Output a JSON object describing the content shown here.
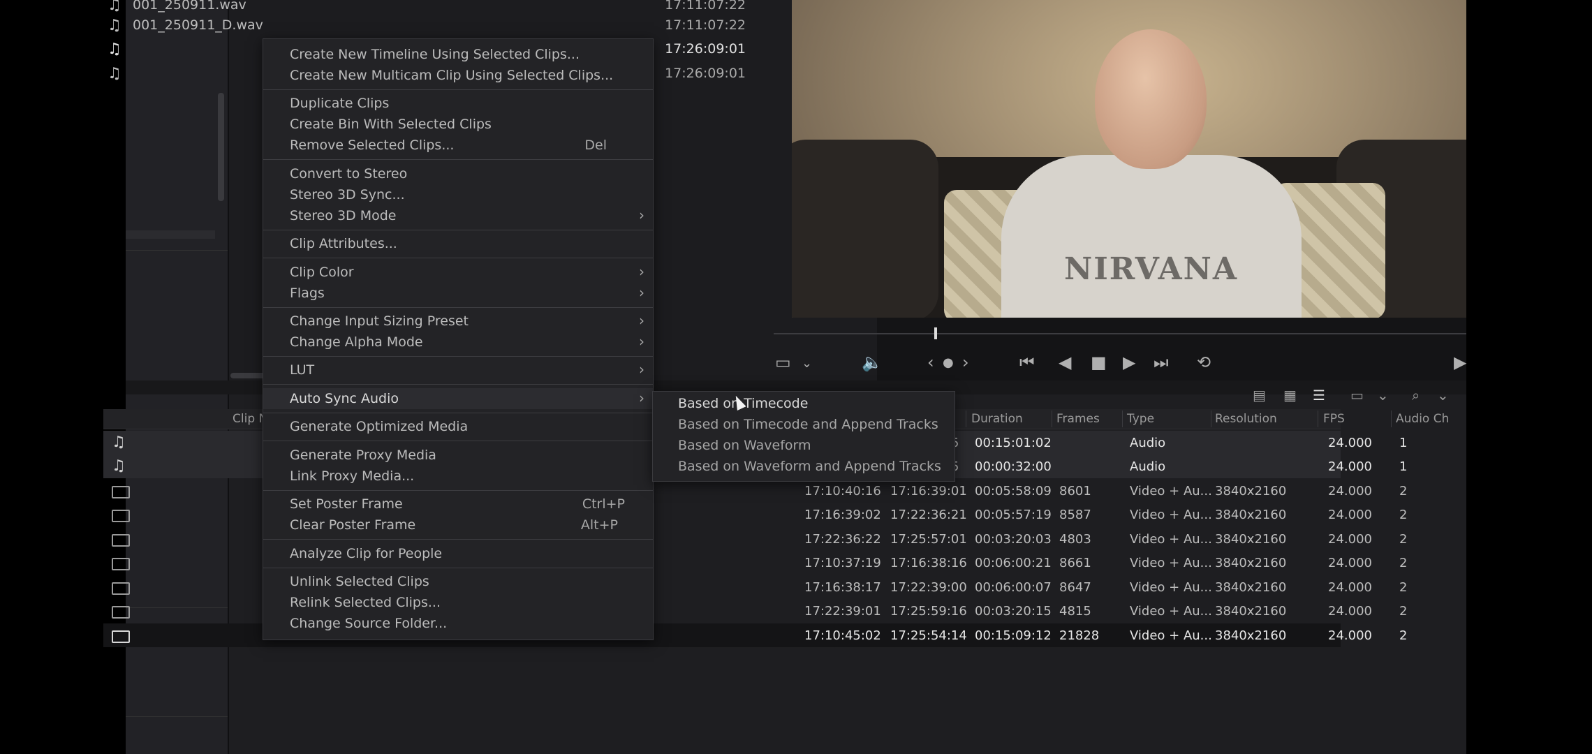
{
  "media_pool": {
    "rows": [
      {
        "name": "001_250911.wav",
        "timecode": "17:11:07:22"
      },
      {
        "name": "001_250911_D.wav",
        "timecode": "17:11:07:22"
      },
      {
        "name": "",
        "timecode": "17:26:09:01"
      },
      {
        "name": "",
        "timecode": "17:26:09:01"
      }
    ]
  },
  "video": {
    "shirt_text": "NIRVANA"
  },
  "bin": {
    "first_column_label": "Clip N",
    "columns": [
      "Duration",
      "Frames",
      "Type",
      "Resolution",
      "FPS",
      "Audio Ch"
    ],
    "rows": [
      {
        "icon": "audio",
        "start": "",
        "end": "",
        "end_fragment": "5",
        "duration": "00:15:01:02",
        "frames": "",
        "type": "Audio",
        "resolution": "",
        "fps": "24.000",
        "audio_ch": "1"
      },
      {
        "icon": "audio",
        "start": "",
        "end": "",
        "end_fragment": "5",
        "duration": "00:00:32:00",
        "frames": "",
        "type": "Audio",
        "resolution": "",
        "fps": "24.000",
        "audio_ch": "1"
      },
      {
        "icon": "clip",
        "start": "17:10:40:16",
        "end": "17:16:39:01",
        "end_fragment": "",
        "duration": "00:05:58:09",
        "frames": "8601",
        "type": "Video + Au...",
        "resolution": "3840x2160",
        "fps": "24.000",
        "audio_ch": "2"
      },
      {
        "icon": "clip",
        "start": "17:16:39:02",
        "end": "17:22:36:21",
        "end_fragment": "",
        "duration": "00:05:57:19",
        "frames": "8587",
        "type": "Video + Au...",
        "resolution": "3840x2160",
        "fps": "24.000",
        "audio_ch": "2"
      },
      {
        "icon": "clip",
        "start": "17:22:36:22",
        "end": "17:25:57:01",
        "end_fragment": "",
        "duration": "00:03:20:03",
        "frames": "4803",
        "type": "Video + Au...",
        "resolution": "3840x2160",
        "fps": "24.000",
        "audio_ch": "2"
      },
      {
        "icon": "clip",
        "start": "17:10:37:19",
        "end": "17:16:38:16",
        "end_fragment": "",
        "duration": "00:06:00:21",
        "frames": "8661",
        "type": "Video + Au...",
        "resolution": "3840x2160",
        "fps": "24.000",
        "audio_ch": "2"
      },
      {
        "icon": "clip",
        "start": "17:16:38:17",
        "end": "17:22:39:00",
        "end_fragment": "",
        "duration": "00:06:00:07",
        "frames": "8647",
        "type": "Video + Au...",
        "resolution": "3840x2160",
        "fps": "24.000",
        "audio_ch": "2"
      },
      {
        "icon": "clip",
        "start": "17:22:39:01",
        "end": "17:25:59:16",
        "end_fragment": "",
        "duration": "00:03:20:15",
        "frames": "4815",
        "type": "Video + Au...",
        "resolution": "3840x2160",
        "fps": "24.000",
        "audio_ch": "2"
      },
      {
        "icon": "clip",
        "start": "17:10:45:02",
        "end": "17:25:54:14",
        "end_fragment": "",
        "duration": "00:15:09:12",
        "frames": "21828",
        "type": "Video + Au...",
        "resolution": "3840x2160",
        "fps": "24.000",
        "audio_ch": "2"
      }
    ]
  },
  "context_menu": {
    "items": [
      {
        "label": "Create New Timeline Using Selected Clips...",
        "shortcut": "",
        "submenu": false
      },
      {
        "label": "Create New Multicam Clip Using Selected Clips...",
        "shortcut": "",
        "submenu": false
      },
      {
        "label": "Duplicate Clips",
        "shortcut": "",
        "submenu": false
      },
      {
        "label": "Create Bin With Selected Clips",
        "shortcut": "",
        "submenu": false
      },
      {
        "label": "Remove Selected Clips...",
        "shortcut": "Del",
        "submenu": false
      },
      {
        "label": "Convert to Stereo",
        "shortcut": "",
        "submenu": false
      },
      {
        "label": "Stereo 3D Sync...",
        "shortcut": "",
        "submenu": false
      },
      {
        "label": "Stereo 3D Mode",
        "shortcut": "",
        "submenu": true
      },
      {
        "label": "Clip Attributes...",
        "shortcut": "",
        "submenu": false
      },
      {
        "label": "Clip Color",
        "shortcut": "",
        "submenu": true
      },
      {
        "label": "Flags",
        "shortcut": "",
        "submenu": true
      },
      {
        "label": "Change Input Sizing Preset",
        "shortcut": "",
        "submenu": true
      },
      {
        "label": "Change Alpha Mode",
        "shortcut": "",
        "submenu": true
      },
      {
        "label": "LUT",
        "shortcut": "",
        "submenu": true
      },
      {
        "label": "Auto Sync Audio",
        "shortcut": "",
        "submenu": true
      },
      {
        "label": "Generate Optimized Media",
        "shortcut": "",
        "submenu": false
      },
      {
        "label": "Generate Proxy Media",
        "shortcut": "",
        "submenu": false
      },
      {
        "label": "Link Proxy Media...",
        "shortcut": "",
        "submenu": false
      },
      {
        "label": "Set Poster Frame",
        "shortcut": "Ctrl+P",
        "submenu": false
      },
      {
        "label": "Clear Poster Frame",
        "shortcut": "Alt+P",
        "submenu": false
      },
      {
        "label": "Analyze Clip for People",
        "shortcut": "",
        "submenu": false
      },
      {
        "label": "Unlink Selected Clips",
        "shortcut": "",
        "submenu": false
      },
      {
        "label": "Relink Selected Clips...",
        "shortcut": "",
        "submenu": false
      },
      {
        "label": "Change Source Folder...",
        "shortcut": "",
        "submenu": false
      }
    ]
  },
  "submenu": {
    "items": [
      {
        "label": "Based on Timecode"
      },
      {
        "label": "Based on Timecode and Append Tracks"
      },
      {
        "label": "Based on Waveform"
      },
      {
        "label": "Based on Waveform and Append Tracks"
      }
    ]
  }
}
